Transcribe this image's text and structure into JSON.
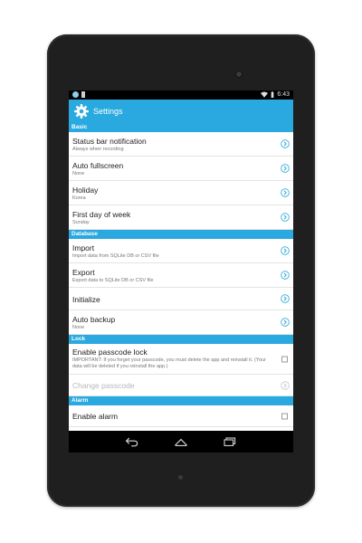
{
  "statusbar": {
    "time": "6:43"
  },
  "appbar": {
    "title": "Settings",
    "icon": "gear-icon"
  },
  "colors": {
    "accent": "#29a9df",
    "chevron": "#29a9df"
  },
  "sections": [
    {
      "header": "Basic",
      "items": [
        {
          "title": "Status bar notification",
          "summary": "Always when recording",
          "control": "chevron"
        },
        {
          "title": "Auto fullscreen",
          "summary": "None",
          "control": "chevron"
        },
        {
          "title": "Holiday",
          "summary": "Korea",
          "control": "chevron"
        },
        {
          "title": "First day of week",
          "summary": "Sunday",
          "control": "chevron"
        }
      ]
    },
    {
      "header": "Database",
      "items": [
        {
          "title": "Import",
          "summary": "Import data from SQLite DB or CSV file",
          "control": "chevron"
        },
        {
          "title": "Export",
          "summary": "Export data to SQLite DB or CSV file",
          "control": "chevron"
        },
        {
          "title": "Initialize",
          "summary": "",
          "control": "chevron"
        },
        {
          "title": "Auto backup",
          "summary": "None",
          "control": "chevron"
        }
      ]
    },
    {
      "header": "Lock",
      "items": [
        {
          "title": "Enable passcode lock",
          "summary": "IMPORTANT: If you forget your passcode, you must delete the app and reinstall it. (Your data will be deleted if you reinstall the app.)",
          "control": "checkbox"
        },
        {
          "title": "Change passcode",
          "summary": "",
          "control": "chevron",
          "disabled": true
        }
      ]
    },
    {
      "header": "Alarm",
      "items": [
        {
          "title": "Enable alarm",
          "summary": "",
          "control": "checkbox"
        }
      ]
    }
  ],
  "navbar": {
    "back": "back-icon",
    "home": "home-icon",
    "recents": "recents-icon"
  }
}
